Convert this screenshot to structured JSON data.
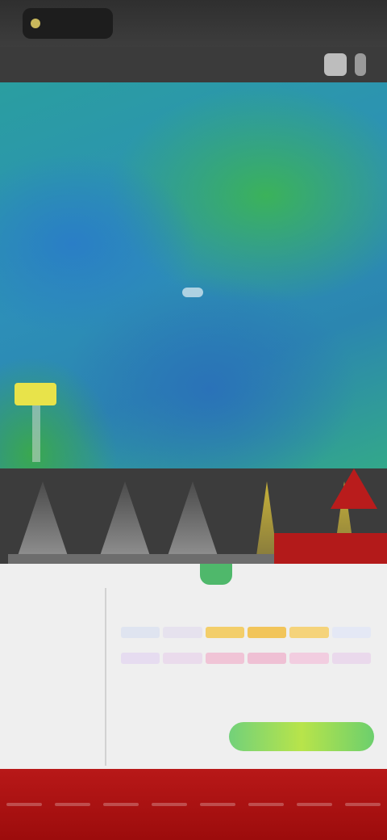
{
  "status_bar": {
    "time": "",
    "right_text": ""
  },
  "toolbar": {
    "title": ""
  },
  "map": {
    "label": "",
    "colors": {
      "green": "#3bb25a",
      "blue": "#2a86b8",
      "yellow": "#e8e34a"
    }
  },
  "timeline": {
    "colors": {
      "peak_red": "#b31a1a",
      "peak_yellow": "#c8b23a"
    }
  },
  "panel": {
    "rows": [
      [
        "#dfe4f0",
        "#e6e2ee",
        "#f3ce6a",
        "#f2c55a",
        "#f5d37a",
        "#e4e8f5"
      ],
      [
        "#e6dcf0",
        "#eadbec",
        "#f0c4d6",
        "#efc0d4",
        "#f2cde0",
        "#ead9ec"
      ]
    ]
  },
  "bottom_nav": {
    "items": [
      "",
      "",
      "",
      "",
      "",
      "",
      "",
      ""
    ]
  }
}
